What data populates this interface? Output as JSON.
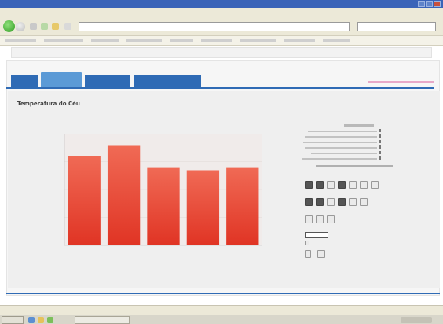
{
  "browser": {
    "title": "",
    "menu": [
      "",
      "",
      "",
      "",
      "",
      ""
    ],
    "address": "",
    "search_placeholder": ""
  },
  "app": {
    "tabs": [
      "",
      "",
      "",
      ""
    ],
    "active_tab_index": 1,
    "page_title": "Temperatura do Céu"
  },
  "chart_data": {
    "type": "bar",
    "categories": [
      "",
      "",
      "",
      "",
      ""
    ],
    "values": [
      88,
      98,
      77,
      74,
      77
    ],
    "ylim": [
      0,
      110
    ],
    "grid": true,
    "title": "",
    "xlabel": "",
    "ylabel": "",
    "bar_color_top": "#f06a55",
    "bar_color_bottom": "#e03424",
    "plot_background": "#f0ebea"
  },
  "colors": {
    "accent": "#2f6bb5",
    "active_tab": "#5b9ad6",
    "link": "#d873a8"
  },
  "toolbar_icons": [
    "chart-bar-icon",
    "copy-icon",
    "refresh-icon",
    "print-icon",
    "table-icon",
    "export-icon",
    "zoom-icon"
  ],
  "statusbar": {
    "text": ""
  }
}
